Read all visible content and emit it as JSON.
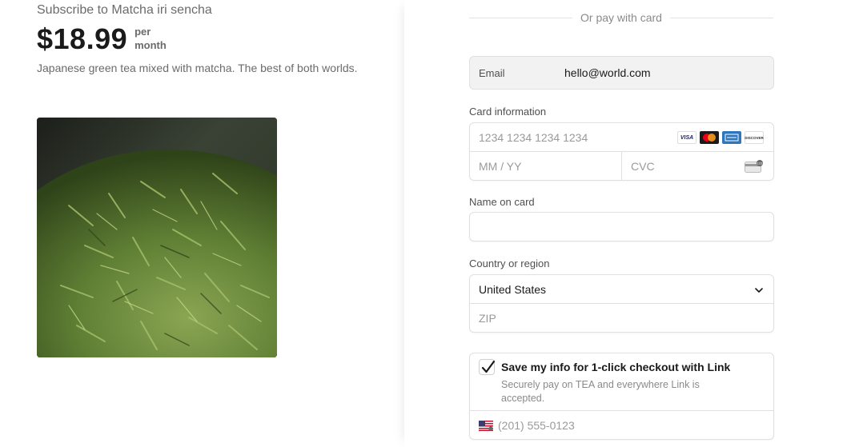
{
  "product": {
    "subscribe_title": "Subscribe to Matcha iri sencha",
    "price": "$18.99",
    "per": "per",
    "period": "month",
    "description": "Japanese green tea mixed with matcha. The best of both worlds."
  },
  "payment": {
    "divider_text": "Or pay with card",
    "email_label": "Email",
    "email_value": "hello@world.com",
    "card_info_label": "Card information",
    "card_number_placeholder": "1234 1234 1234 1234",
    "expiry_placeholder": "MM / YY",
    "cvc_placeholder": "CVC",
    "card_brands": [
      "VISA",
      "DISCOVER"
    ],
    "name_label": "Name on card",
    "name_value": "",
    "region_label": "Country or region",
    "country_value": "United States",
    "zip_placeholder": "ZIP",
    "link_title": "Save my info for 1-click checkout with Link",
    "link_desc": "Securely pay on TEA and everywhere Link is accepted.",
    "link_checked": true,
    "phone_placeholder": "(201) 555-0123"
  },
  "icons": {
    "card_brands": [
      "visa-icon",
      "mastercard-icon",
      "amex-icon",
      "discover-icon"
    ],
    "cvc": "cvc-card-icon",
    "chevron": "chevron-down-icon",
    "checkbox": "checkmark-icon",
    "flag": "us-flag-icon"
  },
  "colors": {
    "accent": "#1a1a1a",
    "muted": "#6b6b6b",
    "border": "#e0e0e0",
    "email_bg": "#f2f2f2"
  }
}
